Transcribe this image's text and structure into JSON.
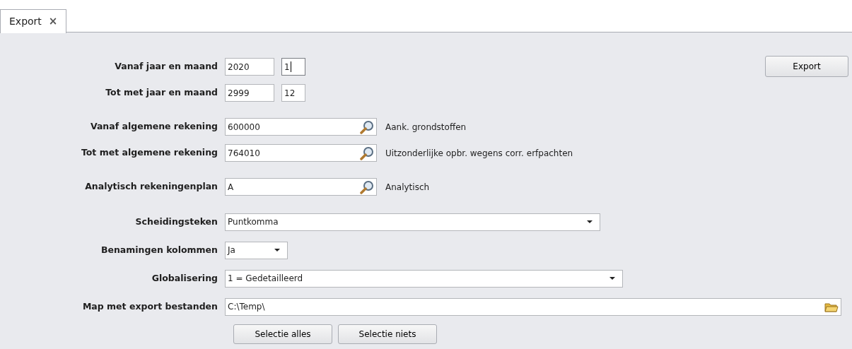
{
  "tabs": [
    {
      "label": "Export",
      "close": "×",
      "selected": true
    }
  ],
  "export_button": {
    "label": "Export"
  },
  "groups": [
    [
      {
        "kind": "period",
        "label": "Vanaf jaar en maand",
        "year": "2020",
        "month": "1",
        "focused": true
      },
      {
        "kind": "period",
        "label": "Tot met jaar en maand",
        "year": "2999",
        "month": "12",
        "focused": false
      }
    ],
    [
      {
        "kind": "lookup",
        "label": "Vanaf algemene rekening",
        "value": "600000",
        "description": "Aank. grondstoffen"
      },
      {
        "kind": "lookup",
        "label": "Tot met algemene rekening",
        "value": "764010",
        "description": "Uitzonderlijke opbr. wegens corr. erfpachten"
      }
    ],
    [
      {
        "kind": "lookup",
        "label": "Analytisch rekeningenplan",
        "value": "A",
        "description": "Analytisch"
      }
    ],
    [
      {
        "kind": "select",
        "label": "Scheidingsteken",
        "value": "Puntkomma"
      },
      {
        "kind": "select",
        "label": "Benamingen kolommen",
        "value": "Ja"
      },
      {
        "kind": "select",
        "label": "Globalisering",
        "value": "1 = Gedetailleerd"
      },
      {
        "kind": "folder",
        "label": "Map met export bestanden",
        "value": "C:\\Temp\\"
      }
    ]
  ],
  "buttons": [
    {
      "label": "Selectie alles"
    },
    {
      "label": "Selectie niets"
    }
  ]
}
